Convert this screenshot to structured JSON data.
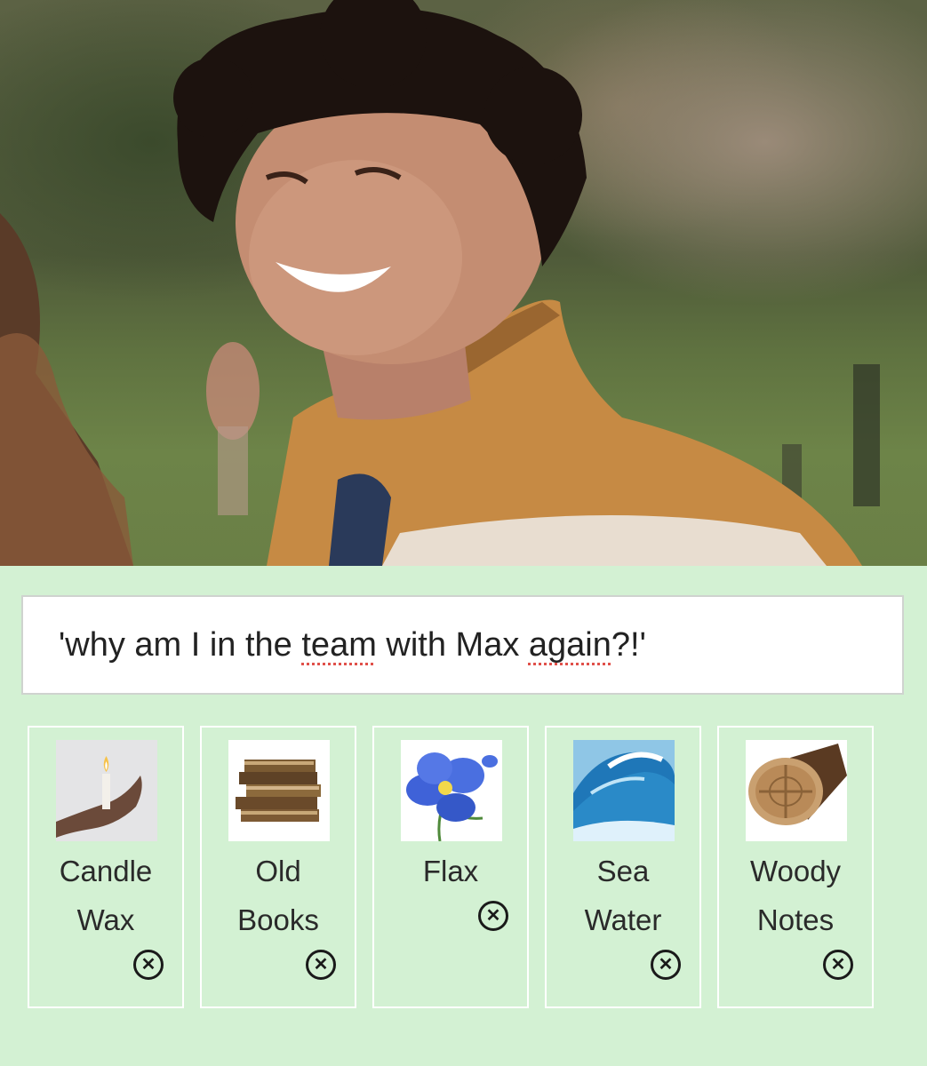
{
  "caption": {
    "before": "'why am I in the ",
    "word1": "team",
    "middle": " with Max ",
    "word2": "again",
    "after": "?!'"
  },
  "notes": [
    {
      "label": "Candle\nWax",
      "icon": "candle-wax-image"
    },
    {
      "label": "Old\nBooks",
      "icon": "old-books-image"
    },
    {
      "label": "Flax",
      "icon": "flax-flower-image"
    },
    {
      "label": "Sea\nWater",
      "icon": "sea-wave-image"
    },
    {
      "label": "Woody\nNotes",
      "icon": "wood-log-image"
    }
  ],
  "remove_icon_glyph": "✕",
  "colors": {
    "background": "#d3f1d3",
    "card_border": "#ffffff",
    "spell_underline": "#e0504a"
  }
}
